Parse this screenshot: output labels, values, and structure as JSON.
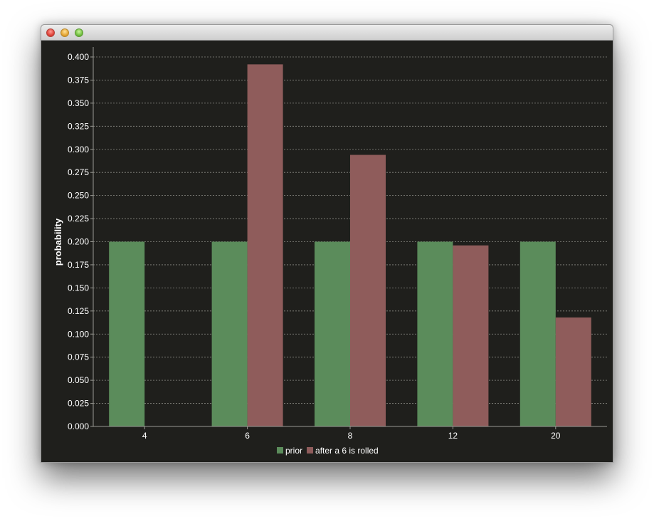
{
  "window": {
    "buttons": [
      "close",
      "minimize",
      "maximize"
    ]
  },
  "colors": {
    "background": "#1f1f1c",
    "prior": "#5b8c5b",
    "posterior": "#8f5c5b",
    "grid": "#8a8a84",
    "text": "#ffffff"
  },
  "chart_data": {
    "type": "bar",
    "title": "",
    "xlabel": "",
    "ylabel": "probability",
    "categories": [
      "4",
      "6",
      "8",
      "12",
      "20"
    ],
    "series": [
      {
        "name": "prior",
        "values": [
          0.2,
          0.2,
          0.2,
          0.2,
          0.2
        ]
      },
      {
        "name": "after a 6 is rolled",
        "values": [
          0.0,
          0.392,
          0.294,
          0.196,
          0.118
        ]
      }
    ],
    "ylim": [
      0,
      0.4
    ],
    "yticks": [
      "0.000",
      "0.025",
      "0.050",
      "0.075",
      "0.100",
      "0.125",
      "0.150",
      "0.175",
      "0.200",
      "0.225",
      "0.250",
      "0.275",
      "0.300",
      "0.325",
      "0.350",
      "0.375",
      "0.400"
    ],
    "grid": true,
    "legend": "bottom-center"
  }
}
